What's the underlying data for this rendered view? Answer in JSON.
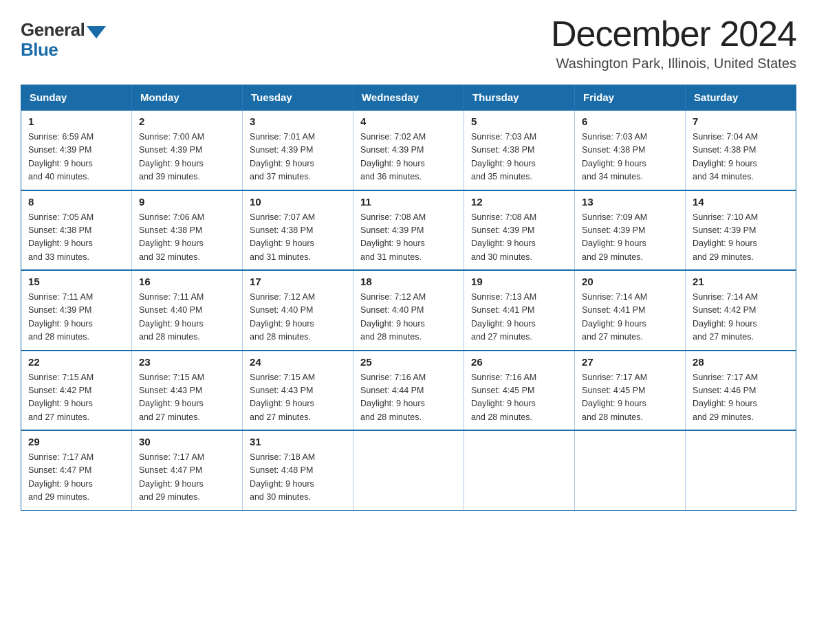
{
  "logo": {
    "general": "General",
    "blue": "Blue"
  },
  "header": {
    "month_year": "December 2024",
    "location": "Washington Park, Illinois, United States"
  },
  "days_of_week": [
    "Sunday",
    "Monday",
    "Tuesday",
    "Wednesday",
    "Thursday",
    "Friday",
    "Saturday"
  ],
  "weeks": [
    [
      {
        "day": "1",
        "sunrise": "6:59 AM",
        "sunset": "4:39 PM",
        "daylight": "9 hours and 40 minutes."
      },
      {
        "day": "2",
        "sunrise": "7:00 AM",
        "sunset": "4:39 PM",
        "daylight": "9 hours and 39 minutes."
      },
      {
        "day": "3",
        "sunrise": "7:01 AM",
        "sunset": "4:39 PM",
        "daylight": "9 hours and 37 minutes."
      },
      {
        "day": "4",
        "sunrise": "7:02 AM",
        "sunset": "4:39 PM",
        "daylight": "9 hours and 36 minutes."
      },
      {
        "day": "5",
        "sunrise": "7:03 AM",
        "sunset": "4:38 PM",
        "daylight": "9 hours and 35 minutes."
      },
      {
        "day": "6",
        "sunrise": "7:03 AM",
        "sunset": "4:38 PM",
        "daylight": "9 hours and 34 minutes."
      },
      {
        "day": "7",
        "sunrise": "7:04 AM",
        "sunset": "4:38 PM",
        "daylight": "9 hours and 34 minutes."
      }
    ],
    [
      {
        "day": "8",
        "sunrise": "7:05 AM",
        "sunset": "4:38 PM",
        "daylight": "9 hours and 33 minutes."
      },
      {
        "day": "9",
        "sunrise": "7:06 AM",
        "sunset": "4:38 PM",
        "daylight": "9 hours and 32 minutes."
      },
      {
        "day": "10",
        "sunrise": "7:07 AM",
        "sunset": "4:38 PM",
        "daylight": "9 hours and 31 minutes."
      },
      {
        "day": "11",
        "sunrise": "7:08 AM",
        "sunset": "4:39 PM",
        "daylight": "9 hours and 31 minutes."
      },
      {
        "day": "12",
        "sunrise": "7:08 AM",
        "sunset": "4:39 PM",
        "daylight": "9 hours and 30 minutes."
      },
      {
        "day": "13",
        "sunrise": "7:09 AM",
        "sunset": "4:39 PM",
        "daylight": "9 hours and 29 minutes."
      },
      {
        "day": "14",
        "sunrise": "7:10 AM",
        "sunset": "4:39 PM",
        "daylight": "9 hours and 29 minutes."
      }
    ],
    [
      {
        "day": "15",
        "sunrise": "7:11 AM",
        "sunset": "4:39 PM",
        "daylight": "9 hours and 28 minutes."
      },
      {
        "day": "16",
        "sunrise": "7:11 AM",
        "sunset": "4:40 PM",
        "daylight": "9 hours and 28 minutes."
      },
      {
        "day": "17",
        "sunrise": "7:12 AM",
        "sunset": "4:40 PM",
        "daylight": "9 hours and 28 minutes."
      },
      {
        "day": "18",
        "sunrise": "7:12 AM",
        "sunset": "4:40 PM",
        "daylight": "9 hours and 28 minutes."
      },
      {
        "day": "19",
        "sunrise": "7:13 AM",
        "sunset": "4:41 PM",
        "daylight": "9 hours and 27 minutes."
      },
      {
        "day": "20",
        "sunrise": "7:14 AM",
        "sunset": "4:41 PM",
        "daylight": "9 hours and 27 minutes."
      },
      {
        "day": "21",
        "sunrise": "7:14 AM",
        "sunset": "4:42 PM",
        "daylight": "9 hours and 27 minutes."
      }
    ],
    [
      {
        "day": "22",
        "sunrise": "7:15 AM",
        "sunset": "4:42 PM",
        "daylight": "9 hours and 27 minutes."
      },
      {
        "day": "23",
        "sunrise": "7:15 AM",
        "sunset": "4:43 PM",
        "daylight": "9 hours and 27 minutes."
      },
      {
        "day": "24",
        "sunrise": "7:15 AM",
        "sunset": "4:43 PM",
        "daylight": "9 hours and 27 minutes."
      },
      {
        "day": "25",
        "sunrise": "7:16 AM",
        "sunset": "4:44 PM",
        "daylight": "9 hours and 28 minutes."
      },
      {
        "day": "26",
        "sunrise": "7:16 AM",
        "sunset": "4:45 PM",
        "daylight": "9 hours and 28 minutes."
      },
      {
        "day": "27",
        "sunrise": "7:17 AM",
        "sunset": "4:45 PM",
        "daylight": "9 hours and 28 minutes."
      },
      {
        "day": "28",
        "sunrise": "7:17 AM",
        "sunset": "4:46 PM",
        "daylight": "9 hours and 29 minutes."
      }
    ],
    [
      {
        "day": "29",
        "sunrise": "7:17 AM",
        "sunset": "4:47 PM",
        "daylight": "9 hours and 29 minutes."
      },
      {
        "day": "30",
        "sunrise": "7:17 AM",
        "sunset": "4:47 PM",
        "daylight": "9 hours and 29 minutes."
      },
      {
        "day": "31",
        "sunrise": "7:18 AM",
        "sunset": "4:48 PM",
        "daylight": "9 hours and 30 minutes."
      },
      null,
      null,
      null,
      null
    ]
  ],
  "labels": {
    "sunrise": "Sunrise:",
    "sunset": "Sunset:",
    "daylight": "Daylight:"
  }
}
